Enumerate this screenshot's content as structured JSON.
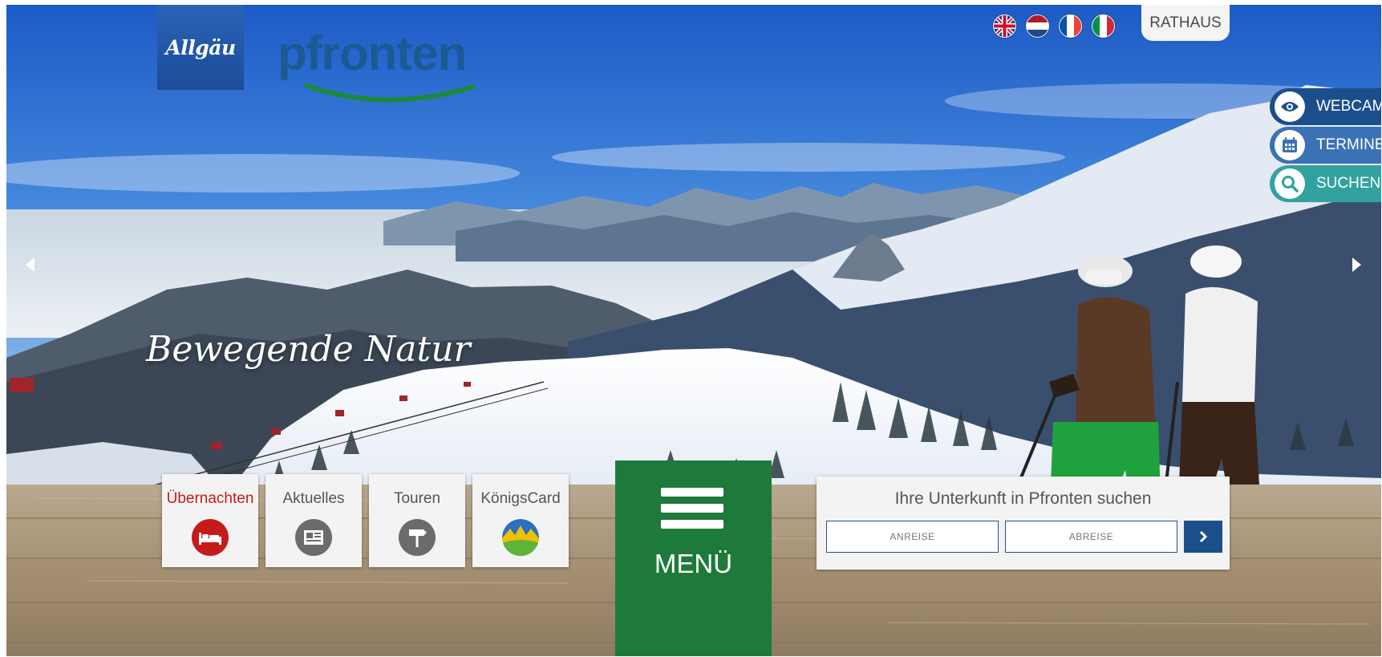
{
  "brand": {
    "allgaeu": "Allgäu",
    "pfronten": "pfronten"
  },
  "languages": [
    "english-flag",
    "dutch-flag",
    "french-flag",
    "italian-flag"
  ],
  "header": {
    "rathaus": "RATHAUS"
  },
  "side_buttons": {
    "webcam": "WEBCAM",
    "termine": "TERMINE",
    "suchen": "SUCHEN"
  },
  "hero": {
    "slogan": "Bewegende Natur"
  },
  "tiles": [
    {
      "label": "Übernachten",
      "icon": "bed-icon",
      "color": "#c61b1b"
    },
    {
      "label": "Aktuelles",
      "icon": "newspaper-icon",
      "color": "#6b6b6b"
    },
    {
      "label": "Touren",
      "icon": "signpost-icon",
      "color": "#6b6b6b"
    },
    {
      "label": "KönigsCard",
      "icon": "koenigscard-icon",
      "color": "#e8b400"
    }
  ],
  "menu": {
    "label": "MENÜ"
  },
  "accommodation_search": {
    "title": "Ihre Unterkunft in Pfronten suchen",
    "arrival_placeholder": "ANREISE",
    "departure_placeholder": "ABREISE"
  },
  "colors": {
    "menu_green": "#1e7a3a",
    "brand_blue": "#1b4f8c",
    "search_teal": "#32a2a0"
  }
}
